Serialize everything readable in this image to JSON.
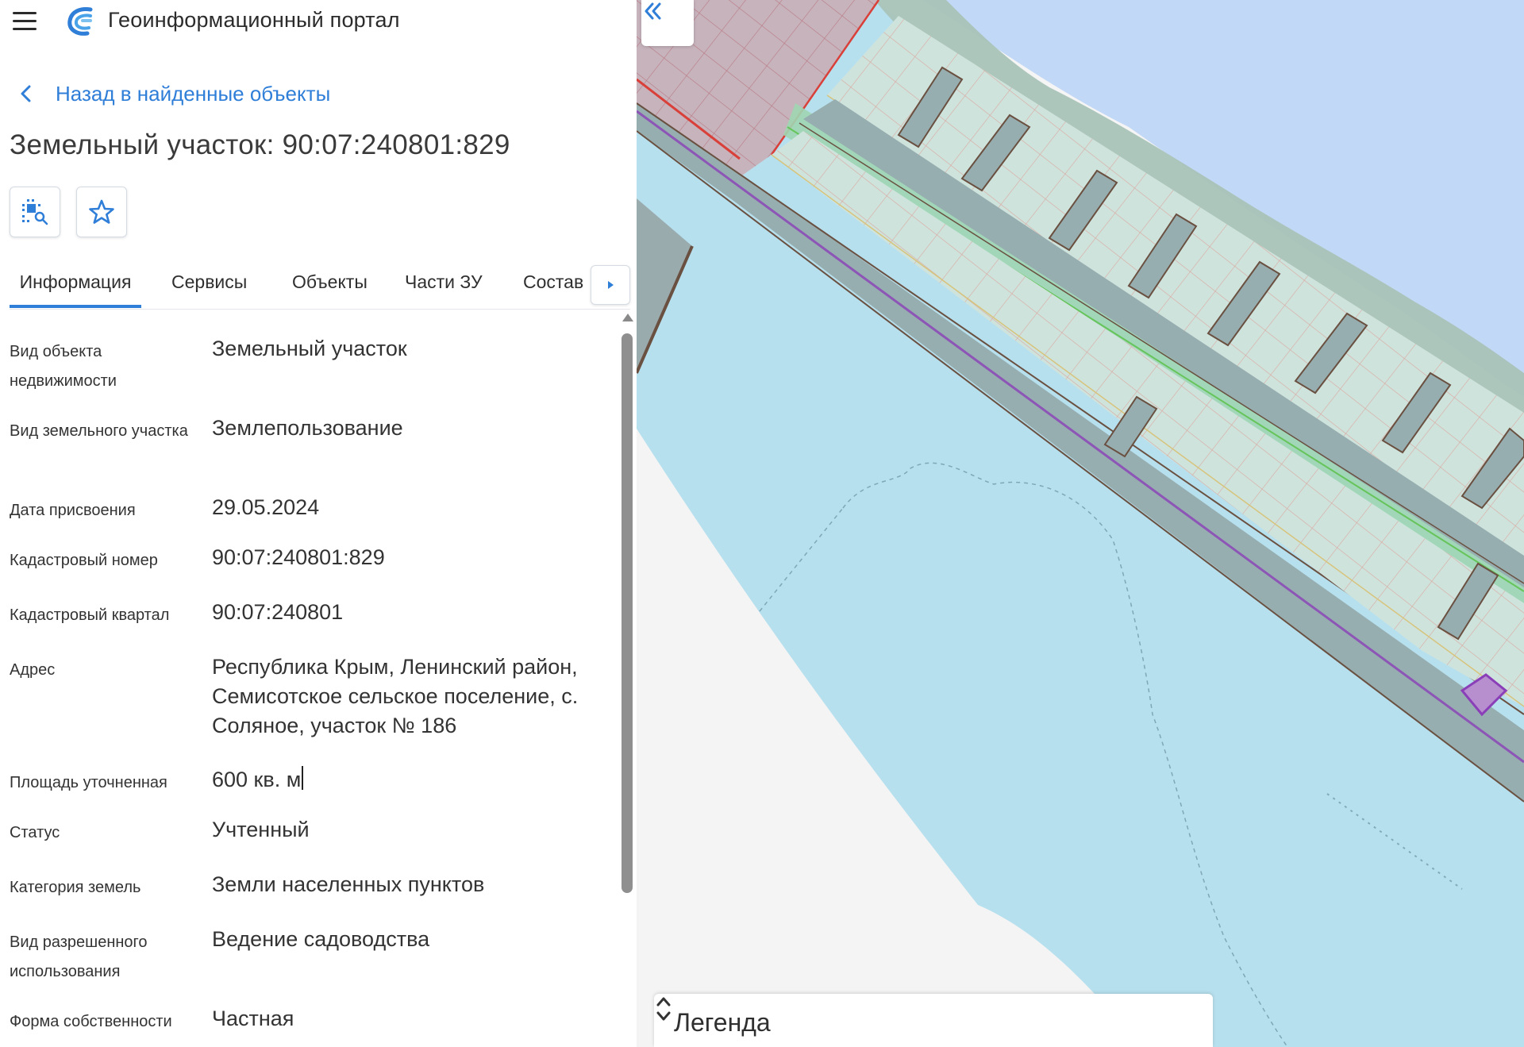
{
  "header": {
    "app_title": "Геоинформационный портал",
    "menu_icon": "hamburger-menu-icon",
    "logo_icon": "portal-logo-icon"
  },
  "back_link": {
    "label": "Назад в найденные объекты",
    "icon": "chevron-left-icon"
  },
  "object": {
    "title": "Земельный участок: 90:07:240801:829"
  },
  "toolbar": {
    "locate_icon": "locate-on-map-icon",
    "favorite_icon": "star-icon"
  },
  "tabs": [
    {
      "label": "Информация",
      "active": true
    },
    {
      "label": "Сервисы",
      "active": false
    },
    {
      "label": "Объекты",
      "active": false
    },
    {
      "label": "Части ЗУ",
      "active": false
    },
    {
      "label": "Состав",
      "active": false
    }
  ],
  "tabs_scroll_icon": "caret-right-icon",
  "info": [
    {
      "label": "Вид объекта недвижимости",
      "value": "Земельный участок"
    },
    {
      "label": "Вид земельного участка",
      "value": "Землепользование"
    },
    {
      "label": "Дата присвоения",
      "value": "29.05.2024"
    },
    {
      "label": "Кадастровый номер",
      "value": "90:07:240801:829"
    },
    {
      "label": "Кадастровый квартал",
      "value": "90:07:240801"
    },
    {
      "label": "Адрес",
      "value": "Республика Крым, Ленинский район, Семисотское сельское поселение, с. Соляное, участок № 186"
    },
    {
      "label": "Площадь уточненная",
      "value": "600 кв. м"
    },
    {
      "label": "Статус",
      "value": "Учтенный"
    },
    {
      "label": "Категория земель",
      "value": "Земли населенных пунктов"
    },
    {
      "label": "Вид разрешенного использования",
      "value": "Ведение садоводства"
    },
    {
      "label": "Форма собственности",
      "value": "Частная"
    }
  ],
  "map": {
    "collapse_icon": "double-chevron-left-icon",
    "legend": {
      "title": "Легенда",
      "toggle_icon": "expand-collapse-icon"
    },
    "colors": {
      "water": "#b7e0ee",
      "sea": "#c2d8f7",
      "land": "#f4f4f4",
      "parcel": "#cfe3dd",
      "road": "#97aeb0",
      "highlight": "#8a3fb8",
      "accent": "#2f7ed8"
    }
  }
}
